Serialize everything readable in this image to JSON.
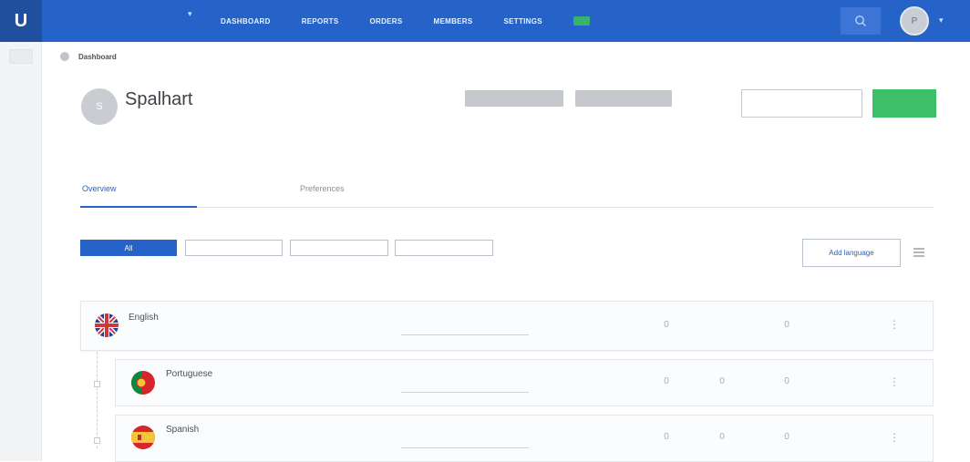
{
  "topbar": {
    "logo": "U",
    "project_name": "",
    "project_count": "",
    "nav": [
      "DASHBOARD",
      "REPORTS",
      "ORDERS",
      "MEMBERS",
      "SETTINGS"
    ],
    "upgrade_label": "",
    "avatar_initial": "P",
    "accent": "#2563c9"
  },
  "breadcrumb": {
    "trail": "",
    "current": "Dashboard"
  },
  "project": {
    "avatar_initial": "S",
    "title": "Spalhart",
    "updated": "",
    "badges": [
      "",
      ""
    ],
    "order_button": "",
    "green_button": ""
  },
  "tabs": [
    "Overview",
    "",
    "Preferences",
    ""
  ],
  "filters": [
    "All",
    "",
    "",
    ""
  ],
  "add_language_label": "Add language",
  "table": {
    "headers": [
      "",
      "",
      "",
      "",
      "",
      "",
      "",
      ""
    ],
    "rows": [
      {
        "name": "English",
        "sub": "",
        "progress_label": "",
        "values": [
          "",
          "0",
          "",
          "0",
          ""
        ],
        "flag": "uk-flag-icon"
      },
      {
        "name": "Portuguese",
        "sub": "",
        "progress_label": "",
        "values": [
          "",
          "0",
          "0",
          "0",
          ""
        ],
        "flag": "portugal-flag-icon"
      },
      {
        "name": "Spanish",
        "sub": "",
        "progress_label": "",
        "values": [
          "",
          "0",
          "0",
          "0",
          ""
        ],
        "flag": "spain-flag-icon"
      }
    ]
  }
}
